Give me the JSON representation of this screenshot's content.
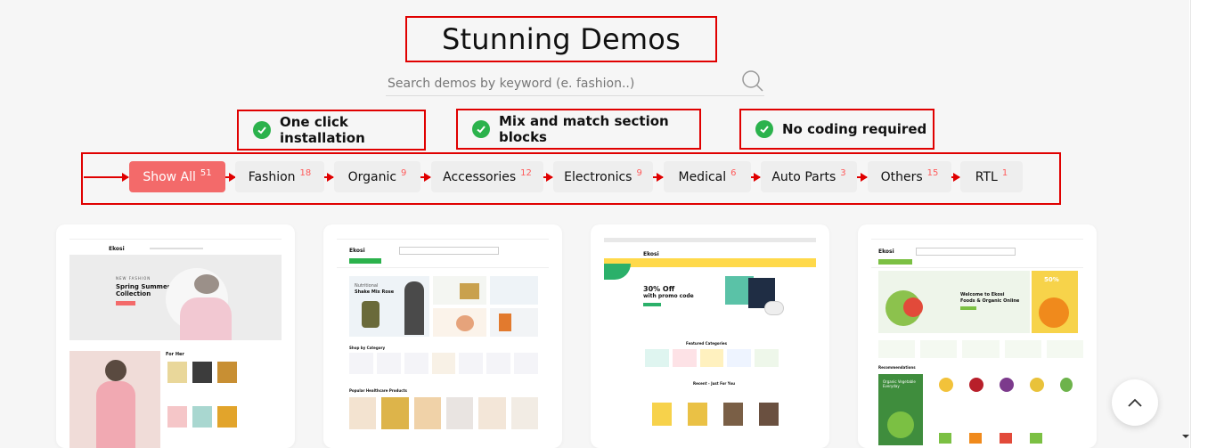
{
  "title": "Stunning Demos",
  "search": {
    "placeholder": "Search demos by keyword (e. fashion..)"
  },
  "features": [
    {
      "label": "One click installation",
      "icon": "check-circle-icon"
    },
    {
      "label": "Mix and match section blocks",
      "icon": "check-circle-icon"
    },
    {
      "label": "No coding required",
      "icon": "check-circle-icon"
    }
  ],
  "filters": [
    {
      "label": "Show All",
      "count": "51",
      "active": true
    },
    {
      "label": "Fashion",
      "count": "18"
    },
    {
      "label": "Organic",
      "count": "9"
    },
    {
      "label": "Accessories",
      "count": "12"
    },
    {
      "label": "Electronics",
      "count": "9"
    },
    {
      "label": "Medical",
      "count": "6"
    },
    {
      "label": "Auto Parts",
      "count": "3"
    },
    {
      "label": "Others",
      "count": "15"
    },
    {
      "label": "RTL",
      "count": "1"
    }
  ],
  "cards": [
    {
      "kind": "fashion",
      "logo": "Ekosi",
      "hero_kicker": "NEW FASHION",
      "hero_title": "Spring Summer",
      "hero_title2": "Collection",
      "section_label": "For Her"
    },
    {
      "kind": "medical",
      "logo": "Ekosi",
      "hero_title": "Nutritional",
      "hero_title2": "Shake Mix Rose",
      "section_label": "Shop by Category",
      "section_label2": "Popular Healthcare Products"
    },
    {
      "kind": "accessories",
      "logo": "Ekosi",
      "hero_title": "30% Off",
      "hero_title2": "with promo code",
      "section_label": "Featured Categories",
      "section_label2": "Recent - Just For You"
    },
    {
      "kind": "organic",
      "logo": "Ekosi",
      "hero_title": "Welcome to Ekosi",
      "hero_title2": "Foods & Organic Online",
      "sale": "50%",
      "section_label": "Recommendations",
      "promo_title": "Organic Vegetable Everyday"
    }
  ],
  "colors": {
    "accent": "#f36a6a",
    "check": "#2bb24c",
    "annotation": "#e00000",
    "count": "#ff5a5a"
  }
}
